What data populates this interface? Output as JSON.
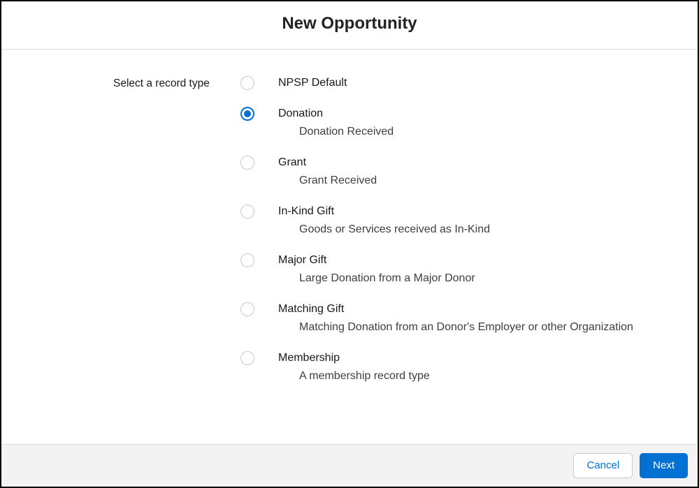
{
  "header": {
    "title": "New Opportunity"
  },
  "prompt": "Select a record type",
  "options": [
    {
      "label": "NPSP Default",
      "description": "",
      "selected": false
    },
    {
      "label": "Donation",
      "description": "Donation Received",
      "selected": true
    },
    {
      "label": "Grant",
      "description": "Grant Received",
      "selected": false
    },
    {
      "label": "In-Kind Gift",
      "description": "Goods or Services received as In-Kind",
      "selected": false
    },
    {
      "label": "Major Gift",
      "description": "Large Donation from a Major Donor",
      "selected": false
    },
    {
      "label": "Matching Gift",
      "description": "Matching Donation from an Donor's Employer or other Organization",
      "selected": false
    },
    {
      "label": "Membership",
      "description": "A membership record type",
      "selected": false
    }
  ],
  "footer": {
    "cancel_label": "Cancel",
    "next_label": "Next"
  }
}
